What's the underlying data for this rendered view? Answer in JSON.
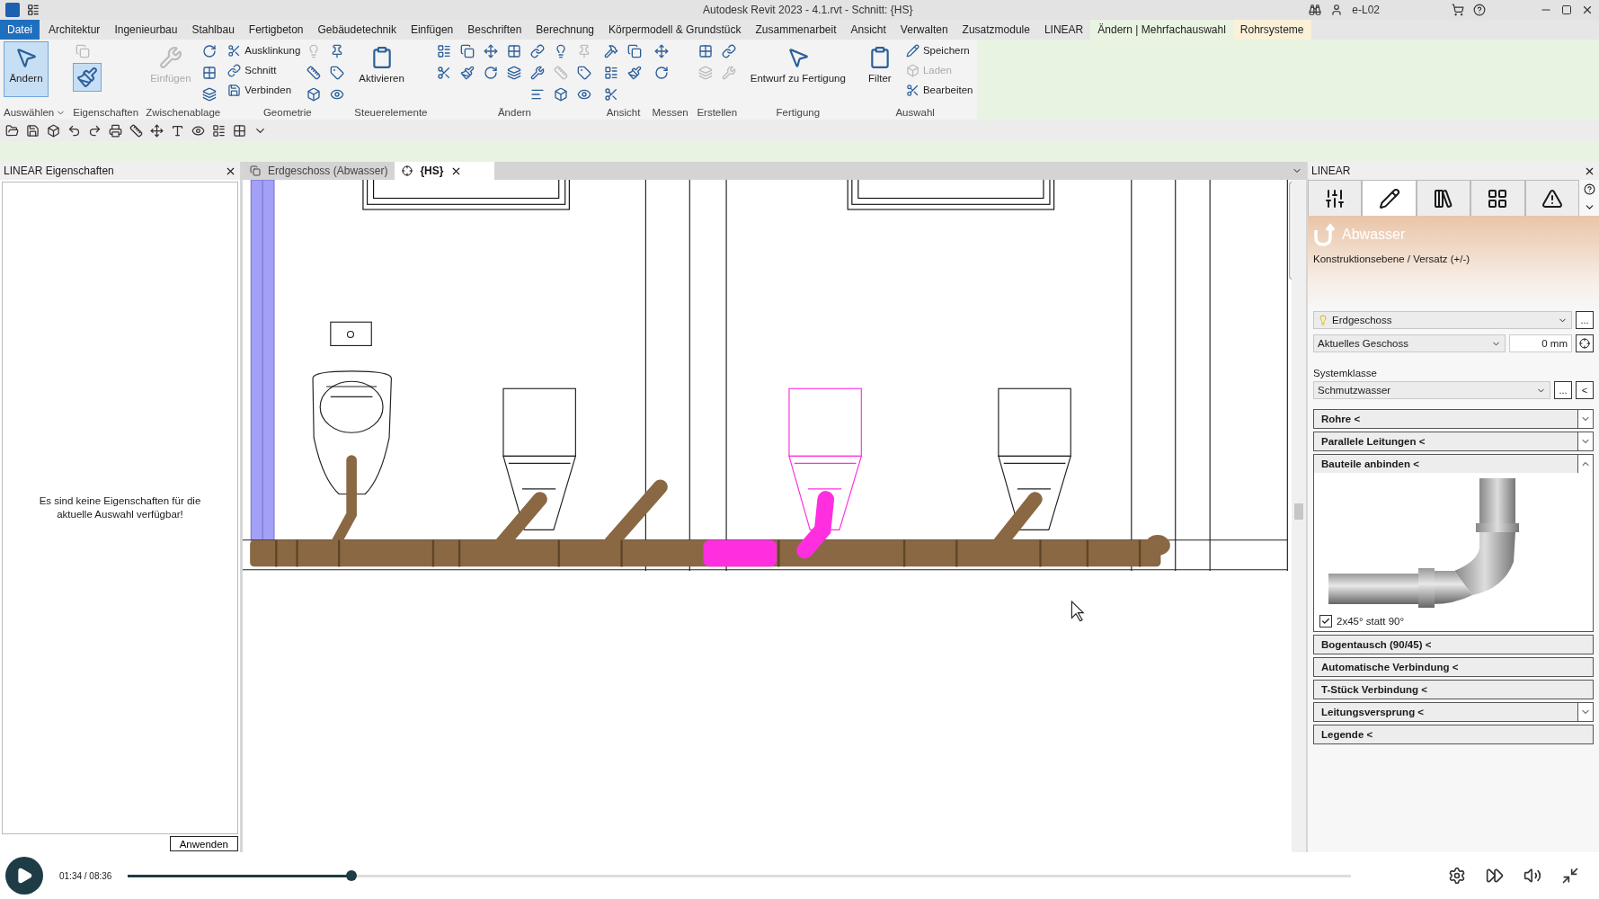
{
  "window": {
    "title": "Autodesk Revit 2023 - 4.1.rvt - Schnitt: {HS}",
    "user": "e-L02"
  },
  "menu_tabs": [
    {
      "label": "Datei",
      "kind": "file",
      "selected": false
    },
    {
      "label": "Architektur",
      "kind": "normal",
      "selected": false
    },
    {
      "label": "Ingenieurbau",
      "kind": "normal",
      "selected": false
    },
    {
      "label": "Stahlbau",
      "kind": "normal",
      "selected": false
    },
    {
      "label": "Fertigbeton",
      "kind": "normal",
      "selected": false
    },
    {
      "label": "Gebäudetechnik",
      "kind": "normal",
      "selected": false
    },
    {
      "label": "Einfügen",
      "kind": "normal",
      "selected": false
    },
    {
      "label": "Beschriften",
      "kind": "normal",
      "selected": false
    },
    {
      "label": "Berechnung",
      "kind": "normal",
      "selected": false
    },
    {
      "label": "Körpermodell & Grundstück",
      "kind": "normal",
      "selected": false
    },
    {
      "label": "Zusammenarbeit",
      "kind": "normal",
      "selected": false
    },
    {
      "label": "Ansicht",
      "kind": "normal",
      "selected": false
    },
    {
      "label": "Verwalten",
      "kind": "normal",
      "selected": false
    },
    {
      "label": "Zusatzmodule",
      "kind": "normal",
      "selected": false
    },
    {
      "label": "LINEAR",
      "kind": "normal",
      "selected": false
    },
    {
      "label": "Ändern | Mehrfachauswahl",
      "kind": "context",
      "selected": true
    },
    {
      "label": "Rohrsysteme",
      "kind": "context_alt",
      "selected": false
    }
  ],
  "ribbon_panels": [
    {
      "label": "Auswählen",
      "dropdown": true,
      "columns": [
        [
          {
            "kind": "large",
            "label": "Ändern",
            "selected": true,
            "disabled": false
          }
        ]
      ]
    },
    {
      "label": "Eigenschaften",
      "dropdown": false,
      "columns": [
        [
          {
            "kind": "icon",
            "selected": false,
            "disabled": true
          },
          {
            "kind": "icon",
            "selected": true,
            "disabled": false
          }
        ]
      ]
    },
    {
      "label": "Zwischenablage",
      "dropdown": false,
      "columns": [
        [
          {
            "kind": "large",
            "label": "Einfügen",
            "selected": false,
            "disabled": true
          }
        ],
        [
          {
            "kind": "icon",
            "selected": false,
            "disabled": false
          },
          {
            "kind": "icon",
            "selected": false,
            "disabled": false
          },
          {
            "kind": "icon",
            "selected": false,
            "disabled": false
          }
        ]
      ]
    },
    {
      "label": "Geometrie",
      "dropdown": false,
      "columns": [
        [
          {
            "kind": "small",
            "label": "Ausklinkung",
            "selected": false,
            "disabled": false
          },
          {
            "kind": "small",
            "label": "Schnitt",
            "selected": false,
            "disabled": false
          },
          {
            "kind": "small",
            "label": "Verbinden",
            "selected": false,
            "disabled": false
          }
        ],
        [
          {
            "kind": "icon",
            "selected": false,
            "disabled": true
          },
          {
            "kind": "icon",
            "selected": false,
            "disabled": false
          },
          {
            "kind": "icon",
            "selected": false,
            "disabled": false
          }
        ],
        [
          {
            "kind": "icon",
            "selected": false,
            "disabled": false
          },
          {
            "kind": "icon",
            "selected": false,
            "disabled": false
          },
          {
            "kind": "icon",
            "selected": false,
            "disabled": false
          }
        ]
      ]
    },
    {
      "label": "Steuerelemente",
      "dropdown": false,
      "columns": [
        [
          {
            "kind": "large",
            "label": "Aktivieren",
            "selected": false,
            "disabled": false
          }
        ]
      ]
    },
    {
      "label": "Ändern",
      "dropdown": false,
      "columns": [
        [
          {
            "kind": "icon",
            "selected": false,
            "disabled": false
          },
          {
            "kind": "icon",
            "selected": false,
            "disabled": false
          }
        ],
        [
          {
            "kind": "icon",
            "selected": false,
            "disabled": false
          },
          {
            "kind": "icon",
            "selected": false,
            "disabled": false
          }
        ],
        [
          {
            "kind": "icon",
            "selected": false,
            "disabled": false
          },
          {
            "kind": "icon",
            "selected": false,
            "disabled": false
          }
        ],
        [
          {
            "kind": "icon",
            "selected": false,
            "disabled": false
          },
          {
            "kind": "icon",
            "selected": false,
            "disabled": false
          }
        ],
        [
          {
            "kind": "icon",
            "selected": false,
            "disabled": false
          },
          {
            "kind": "icon",
            "selected": false,
            "disabled": false
          },
          {
            "kind": "icon",
            "selected": false,
            "disabled": false
          }
        ],
        [
          {
            "kind": "icon",
            "selected": false,
            "disabled": false
          },
          {
            "kind": "icon",
            "selected": false,
            "disabled": true
          },
          {
            "kind": "icon",
            "selected": false,
            "disabled": false
          }
        ],
        [
          {
            "kind": "icon",
            "selected": false,
            "disabled": true
          },
          {
            "kind": "icon",
            "selected": false,
            "disabled": false
          },
          {
            "kind": "icon",
            "selected": false,
            "disabled": false
          }
        ]
      ]
    },
    {
      "label": "Ansicht",
      "dropdown": false,
      "columns": [
        [
          {
            "kind": "icon",
            "selected": false,
            "disabled": false
          },
          {
            "kind": "icon",
            "selected": false,
            "disabled": false
          },
          {
            "kind": "icon",
            "selected": false,
            "disabled": false
          }
        ],
        [
          {
            "kind": "icon",
            "selected": false,
            "disabled": false
          },
          {
            "kind": "icon",
            "selected": false,
            "disabled": false
          }
        ]
      ]
    },
    {
      "label": "Messen",
      "dropdown": false,
      "columns": [
        [
          {
            "kind": "icon",
            "selected": false,
            "disabled": false
          },
          {
            "kind": "icon",
            "selected": false,
            "disabled": false
          }
        ]
      ]
    },
    {
      "label": "Erstellen",
      "dropdown": false,
      "columns": [
        [
          {
            "kind": "icon",
            "selected": false,
            "disabled": false
          },
          {
            "kind": "icon",
            "selected": false,
            "disabled": true
          }
        ],
        [
          {
            "kind": "icon",
            "selected": false,
            "disabled": false
          },
          {
            "kind": "icon",
            "selected": false,
            "disabled": true
          }
        ]
      ]
    },
    {
      "label": "Fertigung",
      "dropdown": false,
      "columns": [
        [
          {
            "kind": "large",
            "label": "Entwurf zu Fertigung",
            "selected": false,
            "disabled": false
          }
        ]
      ]
    },
    {
      "label": "Auswahl",
      "dropdown": false,
      "columns": [
        [
          {
            "kind": "large",
            "label": "Filter",
            "selected": false,
            "disabled": false
          }
        ],
        [
          {
            "kind": "small",
            "label": "Speichern",
            "selected": false,
            "disabled": false
          },
          {
            "kind": "small",
            "label": "Laden",
            "selected": false,
            "disabled": true
          },
          {
            "kind": "small",
            "label": "Bearbeiten",
            "selected": false,
            "disabled": false
          }
        ]
      ]
    }
  ],
  "properties_panel": {
    "title": "LINEAR Eigenschaften",
    "message": "Es sind keine Eigenschaften für die aktuelle Auswahl verfügbar!",
    "apply_button": "Anwenden"
  },
  "view_tabs": [
    {
      "label": "Erdgeschoss (Abwasser)",
      "selected": false
    },
    {
      "label": "{HS}",
      "selected": true
    }
  ],
  "linear_panel": {
    "title": "LINEAR",
    "tabs": [
      {
        "selected": false
      },
      {
        "selected": true
      },
      {
        "selected": false
      },
      {
        "selected": false
      },
      {
        "selected": false
      }
    ],
    "system": "Abwasser",
    "level_label": "Konstruktionsebene / Versatz (+/-)",
    "level": "Erdgeschoss",
    "level_button": "...",
    "offset_reference": "Aktuelles Geschoss",
    "offset": "0 mm",
    "system_class_label": "Systemklasse",
    "system_class": "Schmutzwasser",
    "system_class_buttons": [
      "...",
      "<"
    ],
    "sections": [
      {
        "label": "Rohre <",
        "kind": "toggle",
        "expanded": false
      },
      {
        "label": "Parallele Leitungen <",
        "kind": "toggle",
        "expanded": false
      },
      {
        "label": "Bauteile anbinden <",
        "kind": "toggle",
        "expanded": true,
        "option": {
          "label": "2x45° statt 90°",
          "checked": true
        }
      },
      {
        "label": "Bogentausch (90/45) <",
        "kind": "plain",
        "expanded": false
      },
      {
        "label": "Automatische Verbindung <",
        "kind": "plain",
        "expanded": false
      },
      {
        "label": "T-Stück Verbindung <",
        "kind": "plain",
        "expanded": false
      },
      {
        "label": "Leitungsversprung <",
        "kind": "toggle",
        "expanded": false
      },
      {
        "label": "Legende <",
        "kind": "plain",
        "expanded": false
      }
    ]
  },
  "video_player": {
    "time": "01:34 / 08:36",
    "progress": {
      "level": 0.183
    }
  }
}
